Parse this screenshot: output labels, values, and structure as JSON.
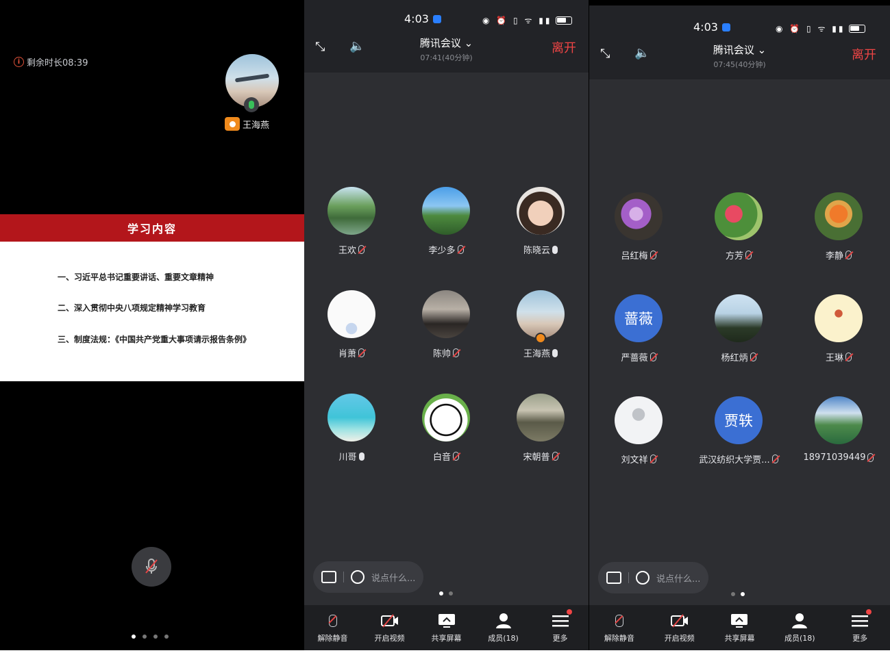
{
  "panel1": {
    "remaining": "剩余时长08:39",
    "speaker_name": "王海燕",
    "slide_title": "学习内容",
    "slide_items": [
      "一、习近平总书记重要讲话、重要文章精神",
      "二、深入贯彻中央八项规定精神学习教育",
      "三、制度法规：《中国共产党重大事项请示报告条例》"
    ]
  },
  "panel2": {
    "time": "4:03",
    "title": "腾讯会议",
    "subtitle": "07:41(40分钟)",
    "leave": "离开",
    "members": [
      {
        "name": "王欢",
        "mic": "off",
        "avatar": "lake"
      },
      {
        "name": "李少多",
        "mic": "off",
        "avatar": "mountain"
      },
      {
        "name": "陈晓云",
        "mic": "on",
        "avatar": "face"
      },
      {
        "name": "肖萧",
        "mic": "off",
        "avatar": "white"
      },
      {
        "name": "陈帅",
        "mic": "off",
        "avatar": "man"
      },
      {
        "name": "王海燕",
        "mic": "on",
        "avatar": "plane",
        "host": true
      },
      {
        "name": "川哥",
        "mic": "on",
        "avatar": "beach"
      },
      {
        "name": "白音",
        "mic": "off",
        "avatar": "panda"
      },
      {
        "name": "宋朝普",
        "mic": "off",
        "avatar": "field"
      }
    ],
    "chat_placeholder": "说点什么..."
  },
  "panel3": {
    "time": "4:03",
    "title": "腾讯会议",
    "subtitle": "07:45(40分钟)",
    "leave": "离开",
    "members": [
      {
        "name": "吕红梅",
        "mic": "off",
        "avatar": "flower-purple"
      },
      {
        "name": "方芳",
        "mic": "off",
        "avatar": "flower-red"
      },
      {
        "name": "李静",
        "mic": "off",
        "avatar": "flower-orange"
      },
      {
        "name": "严蔷薇",
        "mic": "off",
        "avatar_text": "蔷薇"
      },
      {
        "name": "杨红炳",
        "mic": "off",
        "avatar": "palm"
      },
      {
        "name": "王琳",
        "mic": "off",
        "avatar": "cream"
      },
      {
        "name": "刘文祥",
        "mic": "off",
        "avatar": "default"
      },
      {
        "name": "武汉纺织大学贾...",
        "mic": "off",
        "avatar_text": "贾轶"
      },
      {
        "name": "18971039449",
        "mic": "off",
        "avatar": "landscape"
      }
    ],
    "chat_placeholder": "说点什么..."
  },
  "toolbar": {
    "unmute": "解除静音",
    "video": "开启视频",
    "share": "共享屏幕",
    "members": "成员(18)",
    "more": "更多"
  },
  "colors": {
    "leave": "#f04545",
    "bg": "#2d2e32",
    "slide_red": "#b3161b",
    "host": "#f08a1c"
  }
}
